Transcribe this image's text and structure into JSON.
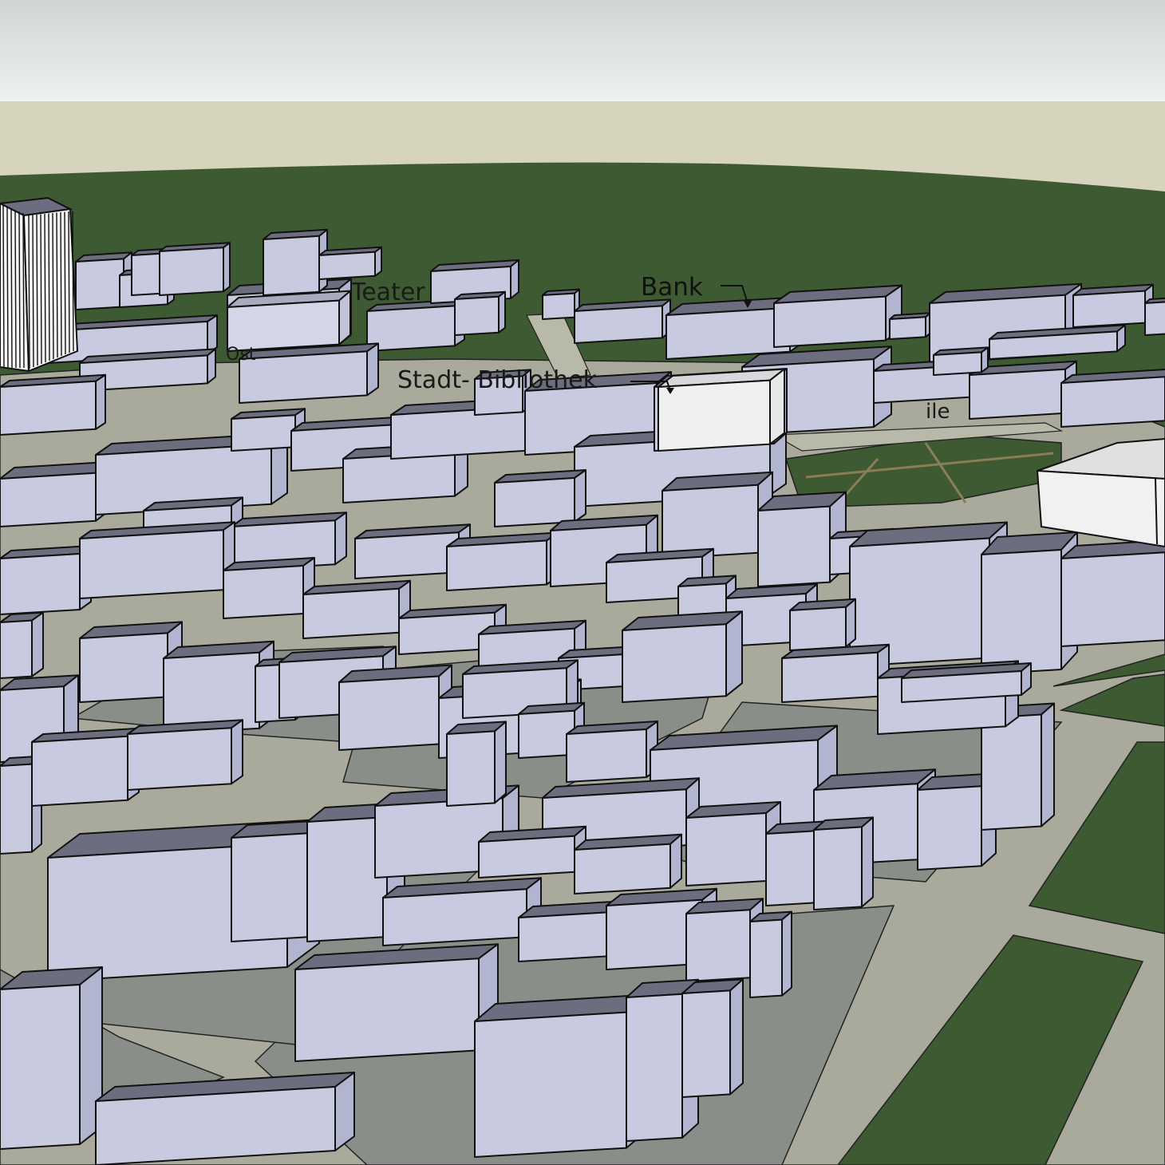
{
  "viewport": {
    "colors": {
      "sky_top": "#cfd6d3",
      "sky_bottom": "#eef2ef",
      "horizon_haze": "#d6d4bc",
      "grass": "#3d5a32",
      "ground": "#a9aa9b",
      "plaza_lot": "#8a8e89",
      "road": "#b8b9a9",
      "building_light": "#c8cae0",
      "building_mid": "#b2b5d0",
      "building_roof": "#6c6e80",
      "building_white": "#f0f0f0",
      "edge": "#111111"
    },
    "icons": [
      "callout-arrow-icon"
    ]
  },
  "labels": {
    "bank": "Bank",
    "teater": "Teater",
    "stadtbibliothek": "Stadt- Bibliothek",
    "fragment_left": "Ost",
    "fragment_right": "ile"
  }
}
